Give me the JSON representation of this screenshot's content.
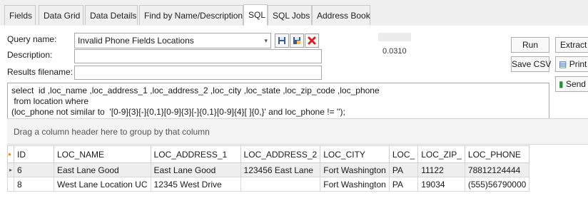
{
  "tabs": [
    {
      "label": "Fields"
    },
    {
      "label": "Data Grid"
    },
    {
      "label": "Data Details"
    },
    {
      "label": "Find by Name/Description"
    },
    {
      "label": "SQL"
    },
    {
      "label": "SQL Jobs"
    },
    {
      "label": "Address Book"
    }
  ],
  "active_tab": "SQL",
  "form": {
    "query_name_label": "Query name:",
    "query_name_value": "Invalid Phone Fields Locations",
    "description_label": "Description:",
    "description_value": "",
    "results_label": "Results filename:",
    "results_value": ""
  },
  "timing": "0.0310",
  "buttons": {
    "run": "Run",
    "save_csv": "Save CSV",
    "extract": "Extract",
    "print": "Print",
    "send": "Send"
  },
  "sql": "select  id ,loc_name ,loc_address_1 ,loc_address_2 ,loc_city ,loc_state ,loc_zip_code ,loc_phone\n from location where\n(loc_phone not similar to  '[0-9]{3}[-]{0,1}[0-9]{3}[-]{0,1}[0-9]{4}[ ]{0,}' and loc_phone != '');",
  "splitter": "...",
  "grid": {
    "group_hint": "Drag a column header here to group by that column",
    "columns": [
      "ID",
      "LOC_NAME",
      "LOC_ADDRESS_1",
      "LOC_ADDRESS_2",
      "LOC_CITY",
      "LOC_",
      "LOC_ZIP_",
      "LOC_PHONE"
    ],
    "rows": [
      [
        "6",
        "East Lane Good",
        "East Lane Good",
        "123456 East Lane",
        "Fort Washington",
        "PA",
        "11122",
        "78812124444"
      ],
      [
        "8",
        "West Lane Location UC",
        "12345 West Drive",
        "",
        "Fort Washington",
        "PA",
        "19034",
        "(555)56790000"
      ]
    ]
  }
}
